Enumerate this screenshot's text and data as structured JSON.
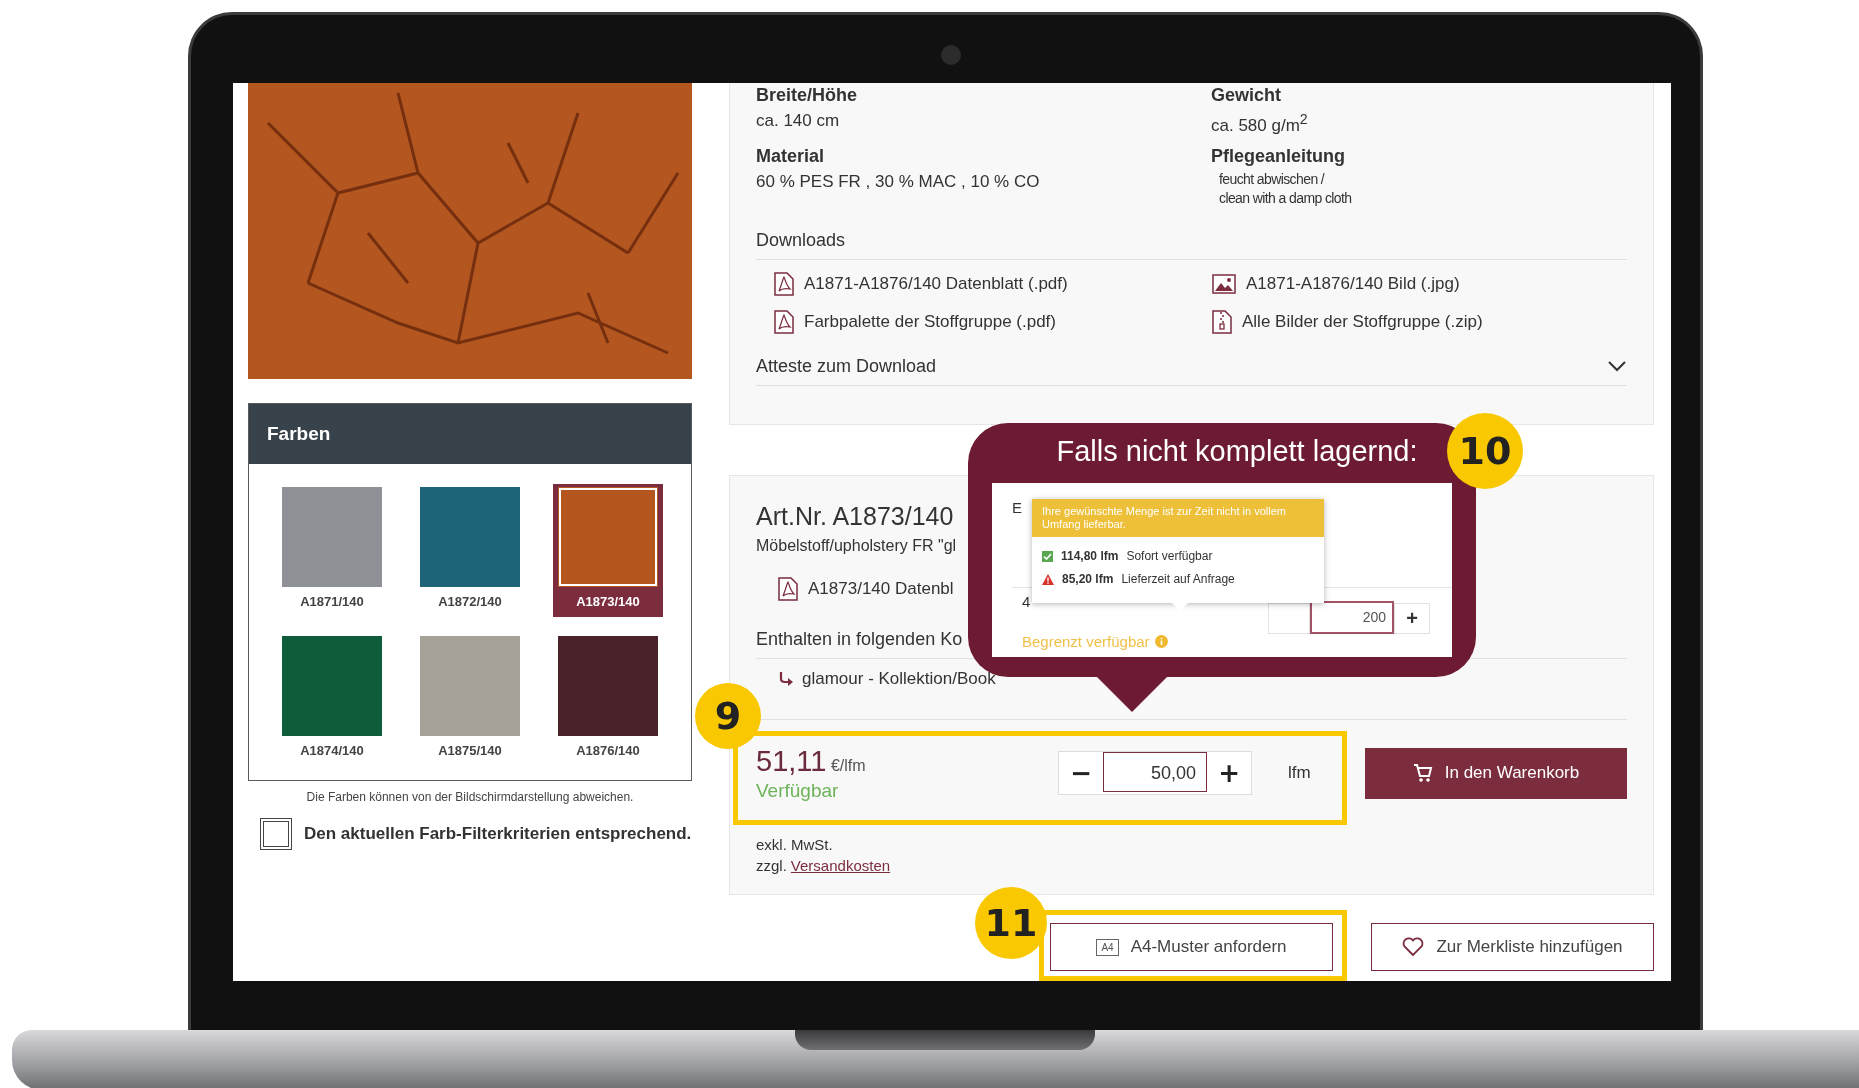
{
  "colors_panel": {
    "title": "Farben",
    "swatches": [
      {
        "code": "A1871/140",
        "color": "#8d9095",
        "selected": false
      },
      {
        "code": "A1872/140",
        "color": "#1e6478",
        "selected": false
      },
      {
        "code": "A1873/140",
        "color": "#b5561f",
        "selected": true
      },
      {
        "code": "A1874/140",
        "color": "#0e5c3a",
        "selected": false
      },
      {
        "code": "A1875/140",
        "color": "#a6a29a",
        "selected": false
      },
      {
        "code": "A1876/140",
        "color": "#4a2229",
        "selected": false
      }
    ],
    "note": "Die Farben können von der Bildschirmdarstellung abweichen.",
    "filter_checkbox": {
      "label": "Den aktuellen Farb-Filterkriterien entsprechend.",
      "checked": false
    }
  },
  "specs": [
    {
      "label": "Breite/Höhe",
      "kind": "text",
      "lines": [
        "ca. 140 cm"
      ]
    },
    {
      "label": "Gewicht",
      "kind": "text",
      "lines": [
        "ca. 580 g/m$^{2}$"
      ]
    },
    {
      "label": "Material",
      "kind": "text",
      "lines": [
        "60 % PES FR , 30 % MAC , 10 % CO"
      ]
    },
    {
      "label": "Pflegeanleitung",
      "kind": "note",
      "lines": [
        "feucht abwischen /",
        "clean with a damp cloth"
      ]
    }
  ],
  "downloads": {
    "title": "Downloads",
    "items": [
      {
        "label": "A1871-A1876/140 Datenblatt (.pdf)",
        "kind": "pdf"
      },
      {
        "label": "A1871-A1876/140 Bild (.jpg)",
        "kind": "image"
      },
      {
        "label": "Farbpalette der Stoffgruppe (.pdf)",
        "kind": "pdf"
      },
      {
        "label": "Alle Bilder der Stoffgruppe (.zip)",
        "kind": "zip"
      }
    ]
  },
  "attests": {
    "label": "Atteste zum Download",
    "expanded": false
  },
  "article": {
    "number": "Art.Nr. A1873/140",
    "description": "Möbelstoff/upholstery FR \"gl",
    "datasheet": "A1873/140 Datenbl",
    "collections_title": "Enthalten in folgenden Ko",
    "collections": [
      "glamour - Kollektion/Book"
    ]
  },
  "purchase": {
    "price": "51,11",
    "unit": "€/lfm",
    "availability": "Verfügbar",
    "minus": "−",
    "quantity": "50,00",
    "plus": "+",
    "qty_unit": "lfm",
    "cart_button": "In den Warenkorb",
    "tax_note": "exkl. MwSt.",
    "shipping_prefix": "zzgl.",
    "shipping_link": "Versandkosten"
  },
  "actions": [
    {
      "label": "A4-Muster anfordern",
      "kind": "sample",
      "icon_text": "A4"
    },
    {
      "label": "Zur Merkliste hinzufügen",
      "kind": "wishlist"
    }
  ],
  "callout": {
    "title": "Falls nicht komplett lagernd:",
    "inset": {
      "partial_label": "E",
      "partial_value": "4",
      "tooltip": {
        "message": "Ihre gewünschte Menge ist zur Zeit nicht in vollem Umfang lieferbar.",
        "rows": [
          {
            "kind": "ok",
            "amount": "114,80 lfm",
            "text": "Sofort verfügbar"
          },
          {
            "kind": "warning",
            "amount": "85,20 lfm",
            "text": "Lieferzeit auf Anfrage"
          }
        ]
      },
      "quantity": "200",
      "plus": "+",
      "status": "Begrenzt verfügbar"
    }
  },
  "annotations": {
    "price_badge": "9",
    "callout_badge": "10",
    "sample_badge": "11"
  }
}
